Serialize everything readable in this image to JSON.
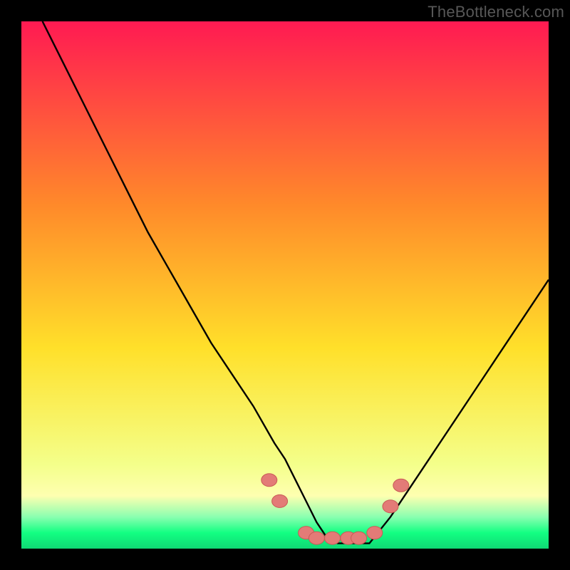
{
  "attribution": "TheBottleneck.com",
  "colors": {
    "frame": "#000000",
    "curve": "#000000",
    "dots_fill": "#e37b77",
    "dots_stroke": "#c95a56",
    "gradient_top": "#ff1a52",
    "gradient_mid_upper": "#ff8a2a",
    "gradient_mid": "#ffe02a",
    "gradient_mid_lower": "#f4ff8a",
    "gradient_band_yellow": "#feffb0",
    "gradient_band_green_light": "#8affb0",
    "gradient_band_green": "#12ff82",
    "gradient_bottom": "#0fd874"
  },
  "chart_data": {
    "type": "line",
    "title": "",
    "xlabel": "",
    "ylabel": "",
    "xlim": [
      0,
      100
    ],
    "ylim": [
      0,
      100
    ],
    "grid": false,
    "legend": false,
    "annotations": [],
    "series": [
      {
        "name": "bottleneck-curve",
        "x": [
          4,
          8,
          12,
          16,
          20,
          24,
          28,
          32,
          36,
          40,
          44,
          48,
          50,
          52,
          54,
          56,
          58,
          60,
          62,
          66,
          70,
          74,
          78,
          82,
          86,
          90,
          94,
          98,
          100
        ],
        "y": [
          100,
          92,
          84,
          76,
          68,
          60,
          53,
          46,
          39,
          33,
          27,
          20,
          17,
          13,
          9,
          5,
          2,
          1,
          1,
          1,
          6,
          12,
          18,
          24,
          30,
          36,
          42,
          48,
          51
        ]
      }
    ],
    "highlight_dots": {
      "name": "optimal-region-dots",
      "points": [
        {
          "x": 47,
          "y": 13
        },
        {
          "x": 49,
          "y": 9
        },
        {
          "x": 54,
          "y": 3
        },
        {
          "x": 56,
          "y": 2
        },
        {
          "x": 59,
          "y": 2
        },
        {
          "x": 62,
          "y": 2
        },
        {
          "x": 64,
          "y": 2
        },
        {
          "x": 67,
          "y": 3
        },
        {
          "x": 70,
          "y": 8
        },
        {
          "x": 72,
          "y": 12
        }
      ]
    }
  }
}
